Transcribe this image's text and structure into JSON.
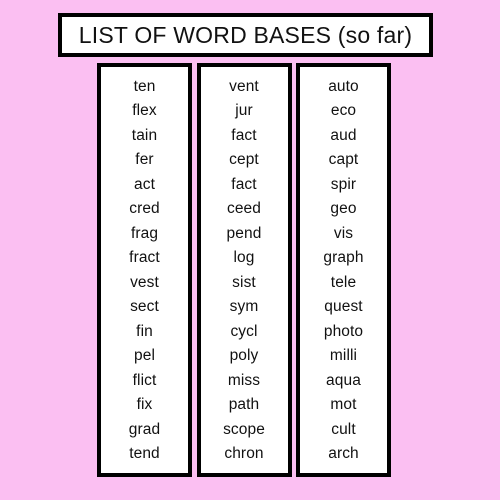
{
  "page": {
    "background_color": "#fbbff2",
    "panel_color": "#ffffff",
    "border_color": "#000000",
    "text_color": "#111111"
  },
  "header": {
    "title": "LIST OF WORD BASES (so far)"
  },
  "table": {
    "columns": [
      {
        "index": 1,
        "words": [
          "ten",
          "flex",
          "tain",
          "fer",
          "act",
          "cred",
          "frag",
          "fract",
          "vest",
          "sect",
          "fin",
          "pel",
          "flict",
          "fix",
          "grad",
          "tend"
        ]
      },
      {
        "index": 2,
        "words": [
          "vent",
          "jur",
          "fact",
          "cept",
          "fact",
          "ceed",
          "pend",
          "log",
          "sist",
          "sym",
          "cycl",
          "poly",
          "miss",
          "path",
          "scope",
          "chron"
        ]
      },
      {
        "index": 3,
        "words": [
          "auto",
          "eco",
          "aud",
          "capt",
          "spir",
          "geo",
          "vis",
          "graph",
          "tele",
          "quest",
          "photo",
          "milli",
          "aqua",
          "mot",
          "cult",
          "arch"
        ]
      }
    ]
  }
}
